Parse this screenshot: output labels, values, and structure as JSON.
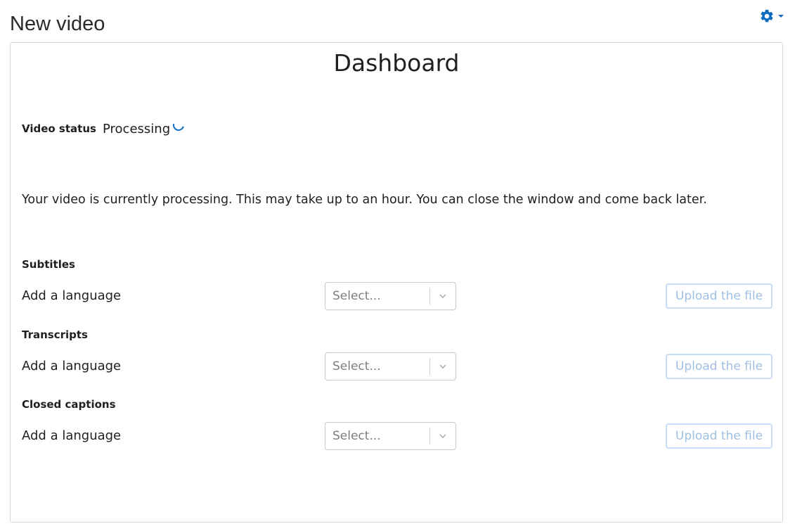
{
  "page": {
    "title": "New video"
  },
  "settings": {
    "icon": "gear-icon",
    "caret_icon": "caret-down-icon",
    "accent_color": "#0f6cbf"
  },
  "dashboard": {
    "heading": "Dashboard",
    "video_status": {
      "label": "Video status",
      "value": "Processing",
      "indicator_icon": "spinner-icon"
    },
    "message": "Your video is currently processing. This may take up to an hour. You can close the window and come back later."
  },
  "sections": [
    {
      "title": "Subtitles",
      "add_label": "Add a language",
      "select_placeholder": "Select...",
      "upload_label": "Upload the file"
    },
    {
      "title": "Transcripts",
      "add_label": "Add a language",
      "select_placeholder": "Select...",
      "upload_label": "Upload the file"
    },
    {
      "title": "Closed captions",
      "add_label": "Add a language",
      "select_placeholder": "Select...",
      "upload_label": "Upload the file"
    }
  ]
}
